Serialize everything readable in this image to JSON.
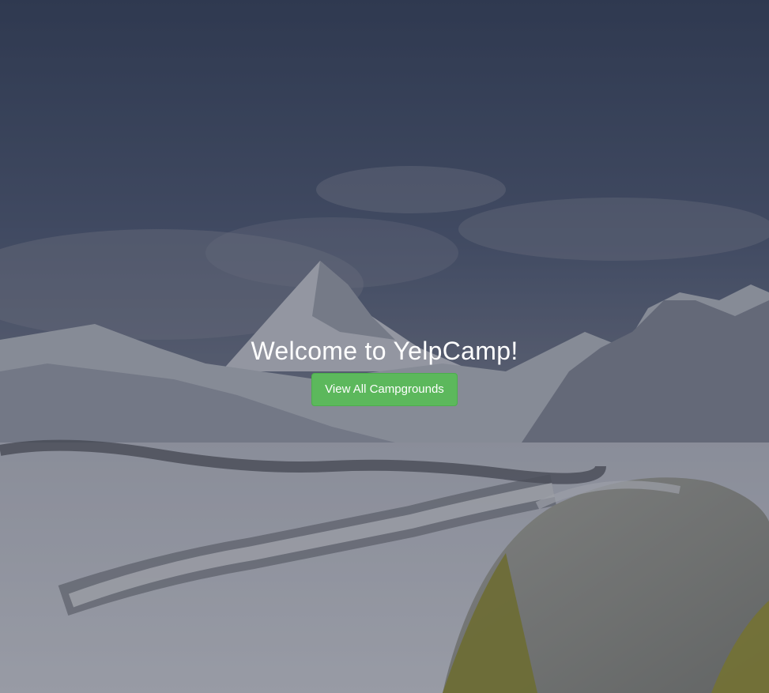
{
  "landing": {
    "title": "Welcome to YelpCamp!",
    "cta_label": "View All Campgrounds"
  },
  "colors": {
    "cta_background": "#5cb85c",
    "title_text": "#ffffff"
  }
}
